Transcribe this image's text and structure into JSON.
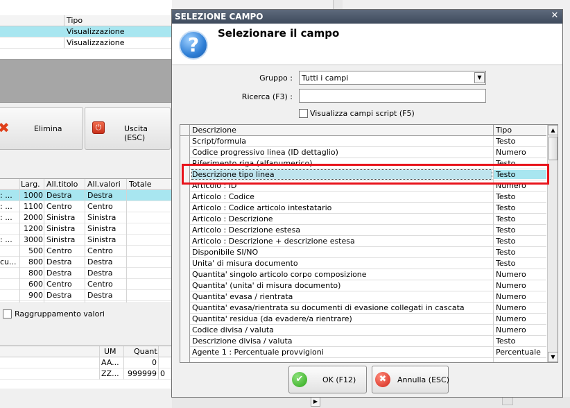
{
  "background": {
    "top_grid": {
      "column_header": "Tipo",
      "rows": [
        "Visualizzazione",
        "Visualizzazione"
      ],
      "selected_row": 0
    },
    "buttons": {
      "delete_label": "Elimina",
      "exit_label": "Uscita (ESC)"
    },
    "columns_grid": {
      "headers": [
        "Larg.",
        "All.titolo",
        "All.valori",
        "Totale"
      ],
      "rows": [
        {
          "lead": ": ...",
          "width": "1000",
          "title_align": "Destra",
          "value_align": "Destra"
        },
        {
          "lead": ": ...",
          "width": "1100",
          "title_align": "Centro",
          "value_align": "Centro"
        },
        {
          "lead": ": ...",
          "width": "2000",
          "title_align": "Sinistra",
          "value_align": "Sinistra"
        },
        {
          "lead": "",
          "width": "1200",
          "title_align": "Sinistra",
          "value_align": "Sinistra"
        },
        {
          "lead": ": ...",
          "width": "3000",
          "title_align": "Sinistra",
          "value_align": "Sinistra"
        },
        {
          "lead": "",
          "width": "500",
          "title_align": "Centro",
          "value_align": "Centro"
        },
        {
          "lead": "cu...",
          "width": "800",
          "title_align": "Destra",
          "value_align": "Destra"
        },
        {
          "lead": "",
          "width": "800",
          "title_align": "Destra",
          "value_align": "Destra"
        },
        {
          "lead": "",
          "width": "600",
          "title_align": "Centro",
          "value_align": "Centro"
        },
        {
          "lead": "",
          "width": "900",
          "title_align": "Destra",
          "value_align": "Destra"
        }
      ],
      "selected_row": 0
    },
    "grouping_checkbox": {
      "label": "Raggruppamento valori",
      "checked": false
    },
    "items_grid": {
      "headers": [
        "UM",
        "Quant."
      ],
      "rows": [
        {
          "um": "AA...",
          "qty": "0"
        },
        {
          "um": "ZZ...",
          "qty": "999999",
          "extra": "0"
        }
      ]
    }
  },
  "dialog": {
    "title": "SELEZIONE CAMPO",
    "heading": "Selezionare il campo",
    "help_icon": "?",
    "group_label": "Gruppo :",
    "group_value": "Tutti i campi",
    "search_label": "Ricerca (F3) :",
    "search_value": "",
    "script_checkbox": {
      "label": "Visualizza campi script (F5)",
      "checked": false
    },
    "columns": [
      "Descrizione",
      "Tipo"
    ],
    "fields": [
      {
        "desc": "Script/formula",
        "type": "Testo"
      },
      {
        "desc": "Codice progressivo linea (ID dettaglio)",
        "type": "Numero"
      },
      {
        "desc": "Riferimento riga (alfanumerico)",
        "type": "Testo"
      },
      {
        "desc": "Descrizione tipo linea",
        "type": "Testo"
      },
      {
        "desc": "Articolo : ID",
        "type": "Numero"
      },
      {
        "desc": "Articolo : Codice",
        "type": "Testo"
      },
      {
        "desc": "Articolo : Codice articolo intestatario",
        "type": "Testo"
      },
      {
        "desc": "Articolo : Descrizione",
        "type": "Testo"
      },
      {
        "desc": "Articolo : Descrizione estesa",
        "type": "Testo"
      },
      {
        "desc": "Articolo : Descrizione + descrizione estesa",
        "type": "Testo"
      },
      {
        "desc": "Disponibile SI/NO",
        "type": "Testo"
      },
      {
        "desc": "Unita' di misura documento",
        "type": "Testo"
      },
      {
        "desc": "Quantita' singolo articolo corpo composizione",
        "type": "Numero"
      },
      {
        "desc": "Quantita' (unita' di misura documento)",
        "type": "Numero"
      },
      {
        "desc": "Quantita' evasa / rientrata",
        "type": "Numero"
      },
      {
        "desc": "Quantita' evasa/rientrata su documenti di evasione collegati in cascata",
        "type": "Numero"
      },
      {
        "desc": "Quantita' residua (da evadere/a rientrare)",
        "type": "Numero"
      },
      {
        "desc": "Codice divisa / valuta",
        "type": "Numero"
      },
      {
        "desc": "Descrizione divisa / valuta",
        "type": "Testo"
      },
      {
        "desc": "Agente 1 : Percentuale provvigioni",
        "type": "Percentuale"
      },
      {
        "desc": "",
        "type": ""
      }
    ],
    "selected_field": 3,
    "ok_label": "OK (F12)",
    "cancel_label": "Annulla (ESC)"
  },
  "colors": {
    "title_bar": "#4e5a6c",
    "selection": "#a8e6f0",
    "highlight_box": "#e8131b"
  }
}
